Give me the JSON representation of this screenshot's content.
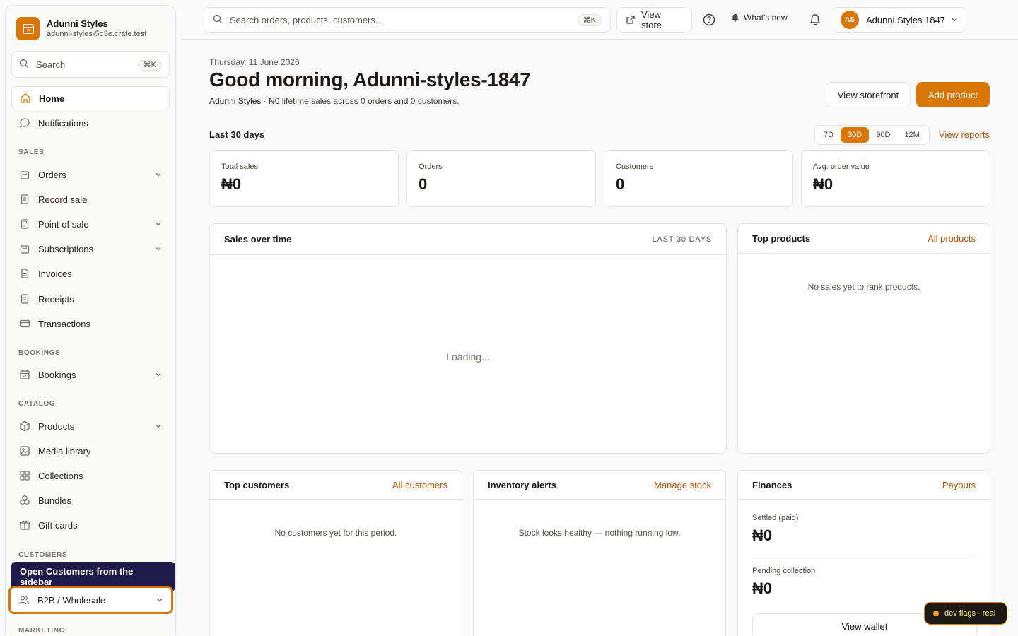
{
  "brand": {
    "name": "Adunni Styles",
    "domain": "adunni-styles-5d3e.crate.test"
  },
  "sidebar": {
    "search_placeholder": "Search",
    "search_shortcut": "⌘K",
    "home": "Home",
    "notifications": "Notifications",
    "sections": {
      "sales": "SALES",
      "bookings": "BOOKINGS",
      "catalog": "CATALOG",
      "customers": "CUSTOMERS",
      "marketing": "MARKETING"
    },
    "sales_items": [
      {
        "label": "Orders",
        "icon": "bag-icon",
        "expandable": true
      },
      {
        "label": "Record sale",
        "icon": "receipt-icon",
        "expandable": false
      },
      {
        "label": "Point of sale",
        "icon": "calculator-icon",
        "expandable": true
      },
      {
        "label": "Subscriptions",
        "icon": "bag-icon",
        "expandable": true
      },
      {
        "label": "Invoices",
        "icon": "document-icon",
        "expandable": false
      },
      {
        "label": "Receipts",
        "icon": "receipt-icon",
        "expandable": false
      },
      {
        "label": "Transactions",
        "icon": "credit-card-icon",
        "expandable": false
      }
    ],
    "bookings_items": [
      {
        "label": "Bookings",
        "icon": "calendar-icon",
        "expandable": true
      }
    ],
    "catalog_items": [
      {
        "label": "Products",
        "icon": "box-icon",
        "expandable": true
      },
      {
        "label": "Media library",
        "icon": "image-icon",
        "expandable": false
      },
      {
        "label": "Collections",
        "icon": "grid-icon",
        "expandable": false
      },
      {
        "label": "Bundles",
        "icon": "bundle-icon",
        "expandable": false
      },
      {
        "label": "Gift cards",
        "icon": "gift-icon",
        "expandable": false
      }
    ],
    "customers_item": "B2B / Wholesale",
    "tooltip": "Open Customers from the sidebar"
  },
  "topbar": {
    "search_placeholder": "Search orders, products, customers...",
    "search_shortcut": "⌘K",
    "view_store": "View store",
    "whats_new": "What's new",
    "account_initials": "AS",
    "account_name": "Adunni Styles 1847"
  },
  "header": {
    "date": "Thursday, 11 June 2026",
    "greeting": "Good morning, Adunni-styles-1847",
    "store_name": "Adunni Styles",
    "summary": " · ₦0 lifetime sales across 0 orders and 0 customers.",
    "view_storefront": "View storefront",
    "add_product": "Add product"
  },
  "period": {
    "label": "Last 30 days",
    "options": [
      "7D",
      "30D",
      "90D",
      "12M"
    ],
    "selected": "30D",
    "view_reports": "View reports"
  },
  "stats": [
    {
      "title": "Total sales",
      "value": "₦0"
    },
    {
      "title": "Orders",
      "value": "0"
    },
    {
      "title": "Customers",
      "value": "0"
    },
    {
      "title": "Avg. order value",
      "value": "₦0"
    }
  ],
  "sales_over_time": {
    "title": "Sales over time",
    "meta": "LAST 30 DAYS",
    "status": "Loading..."
  },
  "top_products": {
    "title": "Top products",
    "link": "All products",
    "empty": "No sales yet to rank products."
  },
  "top_customers": {
    "title": "Top customers",
    "link": "All customers",
    "empty": "No customers yet for this period."
  },
  "inventory": {
    "title": "Inventory alerts",
    "link": "Manage stock",
    "empty": "Stock looks healthy — nothing running low."
  },
  "finances": {
    "title": "Finances",
    "link": "Payouts",
    "settled_label": "Settled (paid)",
    "settled_value": "₦0",
    "pending_label": "Pending collection",
    "pending_value": "₦0",
    "wallet_button": "View wallet"
  },
  "dev_flags": "dev flags · real",
  "colors": {
    "accent": "#d97706",
    "link": "#b45309",
    "tooltip_bg": "#1e1b4b"
  }
}
